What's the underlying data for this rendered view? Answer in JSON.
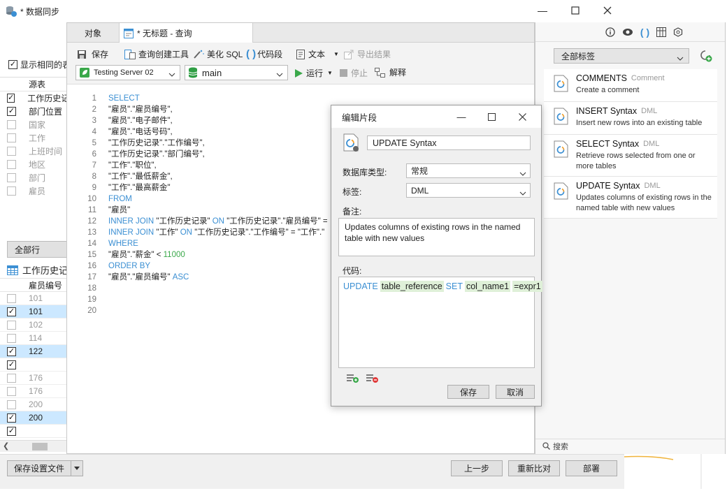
{
  "window": {
    "title": "* 数据同步"
  },
  "left": {
    "show_same_label": "显示相同的表",
    "source_header": "源表",
    "tables": [
      {
        "name": "工作历史记录",
        "checked": true
      },
      {
        "name": "部门位置",
        "checked": true
      },
      {
        "name": "国家",
        "checked": false
      },
      {
        "name": "工作",
        "checked": false
      },
      {
        "name": "上班时间",
        "checked": false
      },
      {
        "name": "地区",
        "checked": false
      },
      {
        "name": "部门",
        "checked": false
      },
      {
        "name": "雇员",
        "checked": false
      }
    ],
    "all_rows_label": "全部行",
    "table_title": "工作历史记录",
    "col_header": "雇员编号",
    "rows": [
      {
        "v": "101",
        "checked": false,
        "hl": false
      },
      {
        "v": "101",
        "checked": true,
        "hl": true
      },
      {
        "v": "102",
        "checked": false,
        "hl": false
      },
      {
        "v": "114",
        "checked": false,
        "hl": false
      },
      {
        "v": "122",
        "checked": true,
        "hl": true
      },
      {
        "v": "",
        "checked": true,
        "hl": false
      },
      {
        "v": "176",
        "checked": false,
        "hl": false
      },
      {
        "v": "176",
        "checked": false,
        "hl": false
      },
      {
        "v": "200",
        "checked": false,
        "hl": false
      },
      {
        "v": "200",
        "checked": true,
        "hl": true
      },
      {
        "v": "",
        "checked": true,
        "hl": false
      }
    ]
  },
  "bottom": {
    "save_profile": "保存设置文件",
    "prev": "上一步",
    "recompare": "重新比对",
    "deploy": "部署"
  },
  "query": {
    "tab_objects": "对象",
    "tab_query": "* 无标题 - 查询",
    "toolbar": {
      "save": "保存",
      "query_builder": "查询创建工具",
      "beautify": "美化 SQL",
      "snippet": "代码段",
      "text": "文本",
      "export": "导出结果",
      "run": "运行",
      "stop": "停止",
      "explain": "解释"
    },
    "connection": "Testing Server 02",
    "database": "main",
    "line_numbers": [
      "1",
      "2",
      "3",
      "4",
      "5",
      "6",
      "7",
      "8",
      "9",
      "10",
      "11",
      "12",
      "13",
      "14",
      "15",
      "16",
      "17",
      "18",
      "19",
      "20"
    ],
    "lines": [
      {
        "t": "SELECT",
        "k": "kw"
      },
      {
        "t": "\"雇员\".\"雇员编号\",",
        "k": "str"
      },
      {
        "t": "\"雇员\".\"电子邮件\",",
        "k": "str"
      },
      {
        "t": "\"雇员\".\"电话号码\",",
        "k": "str"
      },
      {
        "t": "\"工作历史记录\".\"工作编号\",",
        "k": "str"
      },
      {
        "t": "\"工作历史记录\".\"部门编号\",",
        "k": "str"
      },
      {
        "t": "\"工作\".\"职位\",",
        "k": "str"
      },
      {
        "t": "\"工作\".\"最低薪金\",",
        "k": "str"
      },
      {
        "t": "\"工作\".\"最高薪金\"",
        "k": "str"
      },
      {
        "t": "FROM",
        "k": "kw"
      },
      {
        "t": "\"雇员\"",
        "k": "str"
      },
      {
        "parts": [
          [
            "INNER JOIN ",
            "kw"
          ],
          [
            "\"工作历史记录\" ",
            "str"
          ],
          [
            "ON ",
            "kw"
          ],
          [
            "\"工作历史记录\".\"雇员编号\" = ",
            "str"
          ]
        ]
      },
      {
        "parts": [
          [
            "INNER JOIN ",
            "kw"
          ],
          [
            "\"工作\" ",
            "str"
          ],
          [
            "ON ",
            "kw"
          ],
          [
            "\"工作历史记录\".\"工作编号\" = \"工作\".\"",
            "str"
          ]
        ]
      },
      {
        "t": "WHERE",
        "k": "kw"
      },
      {
        "parts": [
          [
            "\"雇员\".\"薪金\" < ",
            "str"
          ],
          [
            "11000",
            "num"
          ]
        ]
      },
      {
        "t": "ORDER BY",
        "k": "kw"
      },
      {
        "parts": [
          [
            "\"雇员\".\"雇员编号\" ",
            "str"
          ],
          [
            "ASC",
            "kw"
          ]
        ]
      },
      {
        "t": "",
        "k": "str"
      },
      {
        "t": "",
        "k": "str"
      },
      {
        "t": "",
        "k": "str"
      }
    ]
  },
  "dialog": {
    "title": "编辑片段",
    "name_value": "UPDATE Syntax",
    "db_type_label": "数据库类型:",
    "db_type_value": "常规",
    "tag_label": "标签:",
    "tag_value": "DML",
    "remark_label": "备注:",
    "remark_value": "Updates columns of existing rows in the named table with new values",
    "code_label": "代码:",
    "code_tokens": [
      {
        "t": "UPDATE",
        "k": "kw"
      },
      {
        "t": "table_reference",
        "k": "ph"
      },
      {
        "t": "SET",
        "k": "kw"
      },
      {
        "t": "col_name1",
        "k": "ph"
      },
      {
        "t": "=expr1",
        "k": "ph"
      }
    ],
    "save": "保存",
    "cancel": "取消"
  },
  "snippets": {
    "filter_value": "全部标签",
    "search_placeholder": "搜索",
    "items": [
      {
        "title": "COMMENTS",
        "tag": "Comment",
        "desc": "Create a comment"
      },
      {
        "title": "INSERT Syntax",
        "tag": "DML",
        "desc": "Insert new rows into an existing table"
      },
      {
        "title": "SELECT Syntax",
        "tag": "DML",
        "desc": "Retrieve rows selected from one or more tables"
      },
      {
        "title": "UPDATE Syntax",
        "tag": "DML",
        "desc": "Updates columns of existing rows in the named table with new values"
      }
    ]
  },
  "colors": {
    "accent": "#3b8fd3",
    "row_highlight": "#cce8ff",
    "number": "#3aa84a",
    "db_green": "#2f9e44"
  }
}
